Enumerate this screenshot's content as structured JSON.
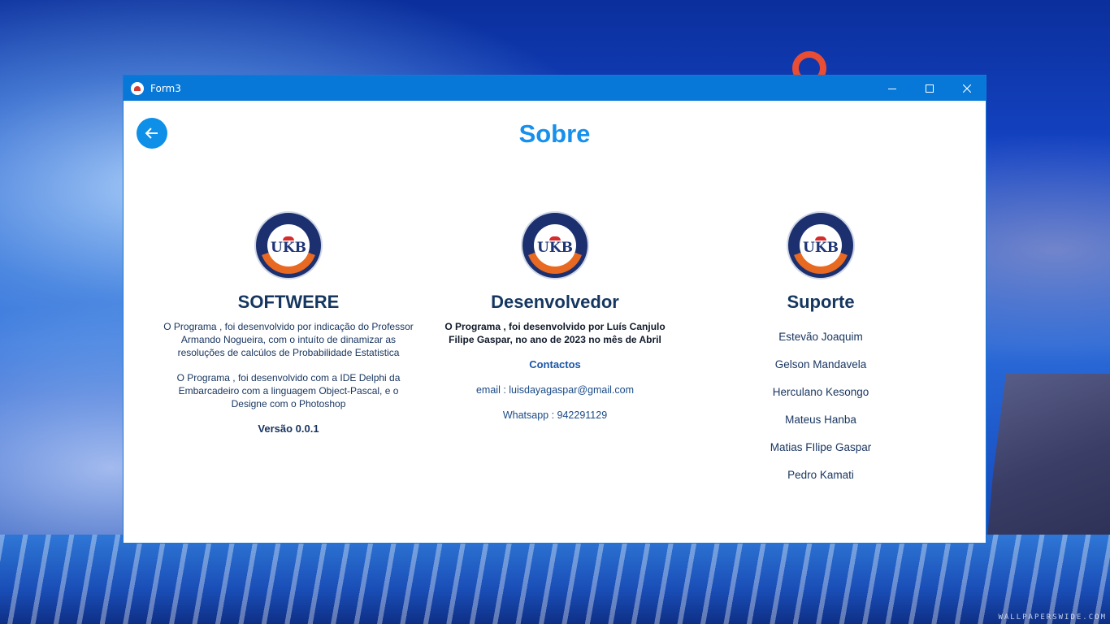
{
  "window": {
    "title": "Form3"
  },
  "page": {
    "title": "Sobre"
  },
  "columns": {
    "software": {
      "title": "SOFTWERE",
      "para1": "O Programa , foi desenvolvido por indicação do Professor Armando Nogueira, com o intuíto de dinamizar  as resoluções de calcúlos de Probabilidade  Estatistica",
      "para2": "O Programa , foi desenvolvido  com a IDE Delphi da Embarcadeiro com a linguagem Object-Pascal, e o Designe com o Photoshop",
      "version": "Versão 0.0.1"
    },
    "developer": {
      "title": "Desenvolvedor",
      "para": "O Programa , foi desenvolvido por Luís Canjulo Filipe Gaspar,  no ano de 2023 no mês de Abril",
      "contacts_title": "Contactos",
      "email": "email : luisdayagaspar@gmail.com",
      "whatsapp": "Whatsapp : 942291129"
    },
    "support": {
      "title": "Suporte",
      "names": [
        "Estevão Joaquim",
        "Gelson Mandavela",
        "Herculano Kesongo",
        "Mateus Hanba",
        "Matias FIlipe Gaspar",
        "Pedro Kamati"
      ]
    }
  },
  "logo": {
    "text": "UKB"
  },
  "colors": {
    "accent": "#1690ec",
    "titlebar": "#0778d7",
    "heading": "#14365f",
    "logo_orange": "#e86a22"
  },
  "icons": {
    "back": "arrow-left-icon",
    "minimize": "minimize-icon",
    "maximize": "maximize-icon",
    "close": "close-icon"
  }
}
